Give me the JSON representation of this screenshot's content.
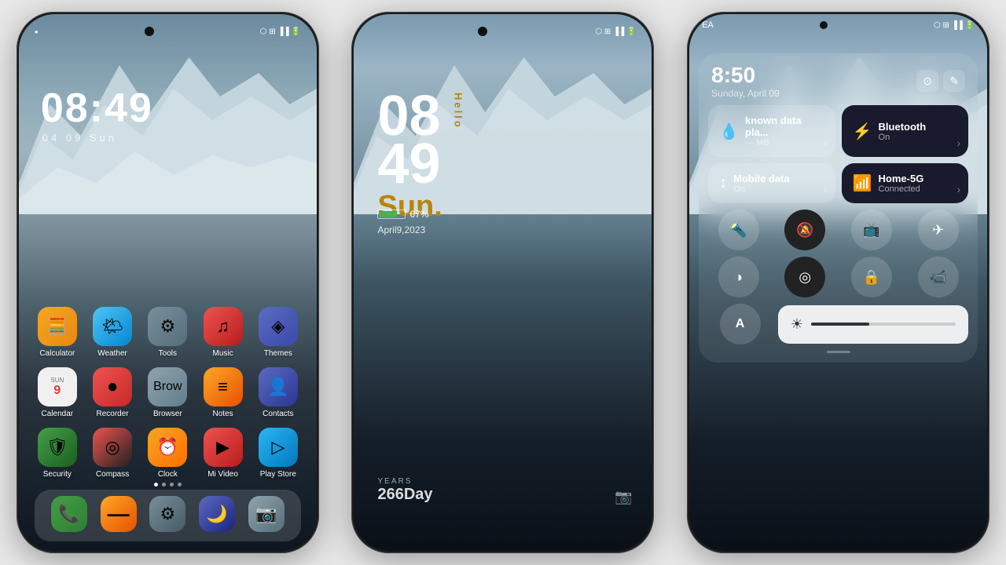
{
  "phone1": {
    "status": {
      "left": "●",
      "time": "08:49",
      "date": "04  09  Sun",
      "right_icons": "⊕ ⊕ ▪ 🔋"
    },
    "time": "08:49",
    "date": "04  09  Sun",
    "apps_row1": [
      {
        "id": "calculator",
        "label": "Calculator",
        "icon": "🧮",
        "class": "icon-calculator"
      },
      {
        "id": "weather",
        "label": "Weather",
        "icon": "🌤",
        "class": "icon-weather"
      },
      {
        "id": "tools",
        "label": "Tools",
        "icon": "⚙",
        "class": "icon-tools"
      },
      {
        "id": "music",
        "label": "Music",
        "icon": "🎵",
        "class": "icon-music"
      },
      {
        "id": "themes",
        "label": "Themes",
        "icon": "🎨",
        "class": "icon-themes"
      }
    ],
    "apps_row2": [
      {
        "id": "calendar",
        "label": "Calendar",
        "icon": "📅",
        "class": "icon-calendar"
      },
      {
        "id": "recorder",
        "label": "Recorder",
        "icon": "⏺",
        "class": "icon-recorder"
      },
      {
        "id": "browser",
        "label": "Browser",
        "icon": "🌐",
        "class": "icon-browser"
      },
      {
        "id": "notes",
        "label": "Notes",
        "icon": "📝",
        "class": "icon-notes"
      },
      {
        "id": "contacts",
        "label": "Contacts",
        "icon": "👤",
        "class": "icon-contacts"
      }
    ],
    "apps_row3": [
      {
        "id": "security",
        "label": "Security",
        "icon": "🛡",
        "class": "icon-security"
      },
      {
        "id": "compass",
        "label": "Compass",
        "icon": "🧭",
        "class": "icon-compass"
      },
      {
        "id": "clock",
        "label": "Clock",
        "icon": "⏰",
        "class": "icon-clock"
      },
      {
        "id": "mivideo",
        "label": "Mi Video",
        "icon": "▶",
        "class": "icon-mivideo"
      },
      {
        "id": "playstore",
        "label": "Play Store",
        "icon": "▷",
        "class": "icon-playstore"
      }
    ],
    "dock": [
      {
        "id": "phone",
        "icon": "📞",
        "class": "icon-phone"
      },
      {
        "id": "minus",
        "icon": "—",
        "class": "icon-minus"
      },
      {
        "id": "settings",
        "icon": "⚙",
        "class": "icon-settings"
      },
      {
        "id": "dark",
        "icon": "🌙",
        "class": "icon-dark"
      },
      {
        "id": "camera-dock",
        "icon": "📷",
        "class": "icon-camera"
      }
    ]
  },
  "phone2": {
    "time_h": "08",
    "time_m": "49",
    "hello": "Hello",
    "day": "Sun.",
    "battery_pct": "67%",
    "date": "April9,2023",
    "years_label": "YEARS",
    "days": "266Day"
  },
  "phone3": {
    "user_initials": "EA",
    "time": "8:50",
    "date": "Sunday, April 09",
    "tiles": [
      {
        "id": "data-plan",
        "title": "known data pla...",
        "sub": "— MB",
        "icon": "💧",
        "active": false
      },
      {
        "id": "bluetooth",
        "title": "Bluetooth",
        "sub": "On",
        "icon": "⬤",
        "active": true
      },
      {
        "id": "mobile-data",
        "title": "Mobile data",
        "sub": "On",
        "icon": "↕",
        "active": false
      },
      {
        "id": "wifi",
        "title": "Home-5G",
        "sub": "Connected",
        "icon": "📶",
        "active": true
      }
    ],
    "quick_buttons": [
      {
        "id": "flashlight",
        "icon": "🔦",
        "active": false
      },
      {
        "id": "mute",
        "icon": "🔕",
        "active": true
      },
      {
        "id": "cast",
        "icon": "📺",
        "active": false
      },
      {
        "id": "airplane",
        "icon": "✈",
        "active": false
      },
      {
        "id": "contrast",
        "icon": "◑",
        "active": false
      },
      {
        "id": "location",
        "icon": "◎",
        "active": true
      },
      {
        "id": "lock-rotate",
        "icon": "🔒",
        "active": false
      },
      {
        "id": "video",
        "icon": "📹",
        "active": false
      }
    ],
    "brightness_level": 40
  }
}
